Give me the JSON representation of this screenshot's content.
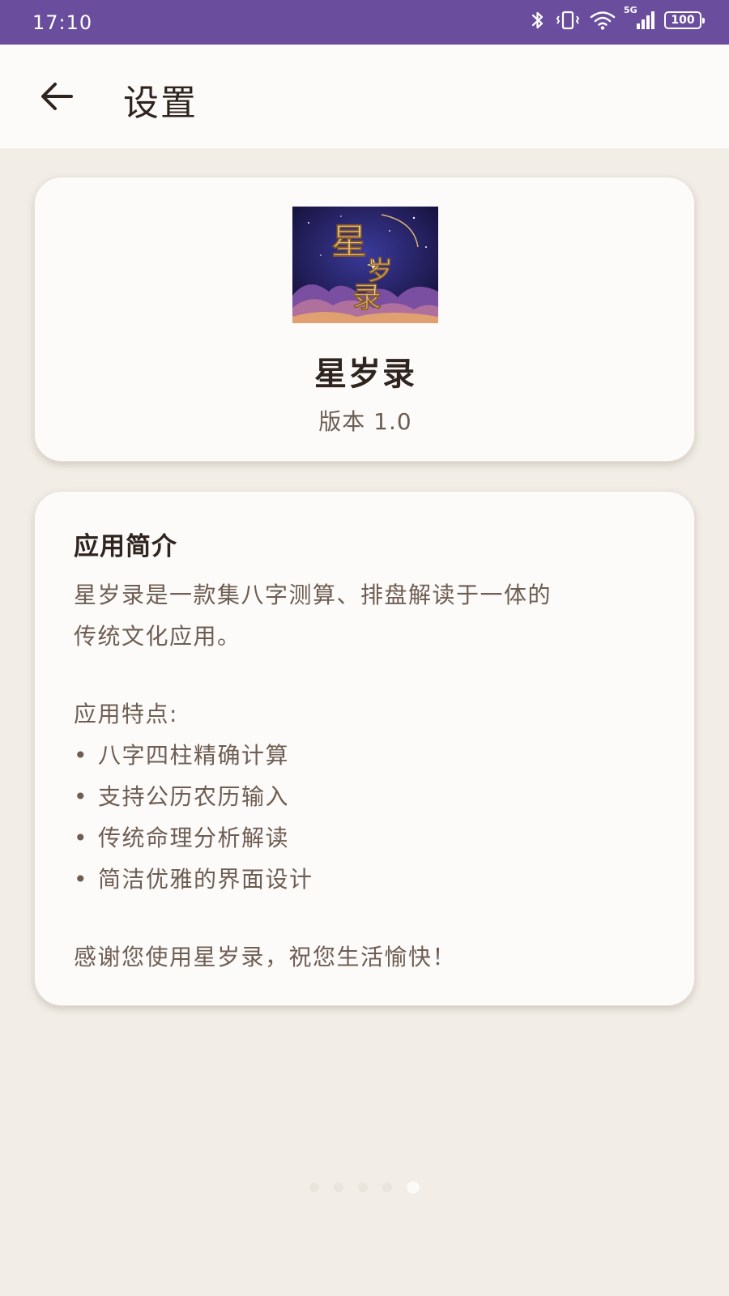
{
  "status_bar": {
    "time": "17:10",
    "network": "5G",
    "battery": "100"
  },
  "app_bar": {
    "title": "设置"
  },
  "app_info": {
    "logo_text": [
      "星",
      "岁",
      "录"
    ],
    "name": "星岁录",
    "version": "版本 1.0"
  },
  "about": {
    "title": "应用简介",
    "intro_line1": "星岁录是一款集八字测算、排盘解读于一体的",
    "intro_line2": "传统文化应用。",
    "features_heading": "应用特点:",
    "features": [
      "八字四柱精确计算",
      "支持公历农历输入",
      "传统命理分析解读",
      "简洁优雅的界面设计"
    ],
    "thanks": "感谢您使用星岁录，祝您生活愉快！"
  },
  "page_indicator": {
    "count": 5,
    "active_index": 4
  },
  "colors": {
    "status_bar": "#6a4e9d",
    "background": "#f2eee7",
    "card": "#fcfbfa",
    "title_text": "#2f241e",
    "body_text": "#6e5d52"
  }
}
